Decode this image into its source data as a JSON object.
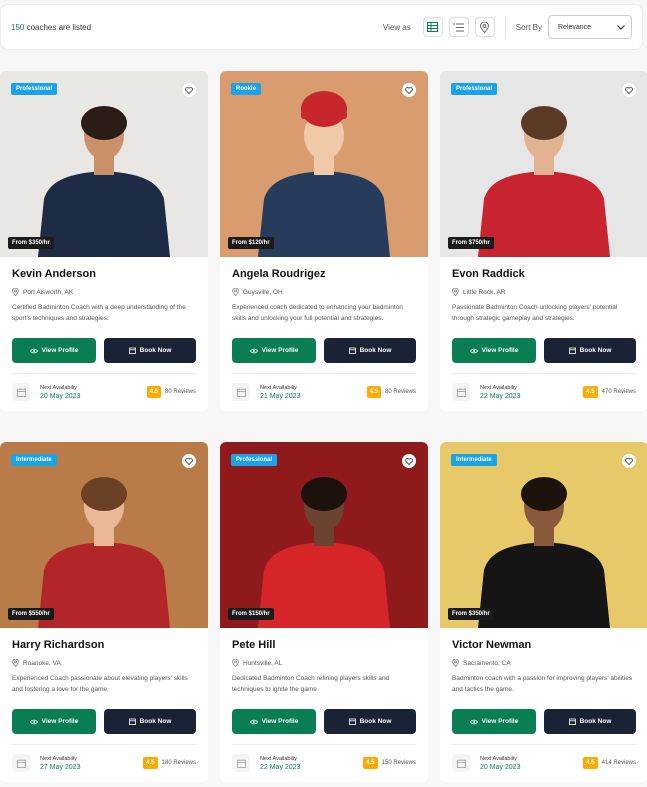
{
  "header": {
    "count_number": "150",
    "count_text": " coaches are listed",
    "view_as": "View as",
    "sort_by": "Sort By",
    "sort_value": "Relevance",
    "icons": [
      "grid-view-icon",
      "list-view-icon",
      "map-pin-icon",
      "chevron-down-icon"
    ]
  },
  "labels": {
    "view_profile": "View Profile",
    "book_now": "Book Now",
    "next_availability": "Next Availabiliy"
  },
  "coaches": [
    {
      "badge": "Professional",
      "price": "From $350/hr",
      "name": "Kevin Anderson",
      "location": "Port Alsworth, AK",
      "description": "Certified Badminton Coach with a deep understanding of the sport's techniques and strategies.",
      "date": "20 May 2023",
      "rating": "4.5",
      "reviews": "80 Reviews",
      "bg": "#e9e7e4",
      "skin": "#c9906a",
      "hair": "#2a1d15",
      "shirt": "#1d2b45",
      "hat": ""
    },
    {
      "badge": "Rookie",
      "price": "From $120/hr",
      "name": "Angela Roudrigez",
      "location": "Guysville, OH",
      "description": "Experienced coach dedicated to enhancing your badminton skills and unlocking your full potential and strategies.",
      "date": "21 May 2023",
      "rating": "4.5",
      "reviews": "80 Reviews",
      "bg": "#d89c6e",
      "skin": "#f0c9a8",
      "hair": "#e4c486",
      "shirt": "#273b5c",
      "hat": "#c7262b"
    },
    {
      "badge": "Professional",
      "price": "From $750/hr",
      "name": "Evon Raddick",
      "location": "Little Rock, AR",
      "description": "Passionate Badminton Coach unlocking players' potential through strategic gameplay and strategies.",
      "date": "22 May 2023",
      "rating": "4.5",
      "reviews": "470 Reviews",
      "bg": "#e6e6e6",
      "skin": "#e3b290",
      "hair": "#5b3a25",
      "shirt": "#c8242f",
      "hat": ""
    },
    {
      "badge": "Intermediate",
      "price": "From $550/hr",
      "name": "Harry Richardson",
      "location": "Roanoke, VA",
      "description": "Experienced Coach passionate about elevating players' skills and fostering a love for the game.",
      "date": "27 May 2023",
      "rating": "4.5",
      "reviews": "180 Reviews",
      "bg": "#b97b47",
      "skin": "#eab896",
      "hair": "#6a4124",
      "shirt": "#b2262a",
      "hat": ""
    },
    {
      "badge": "Professional",
      "price": "From $150/hr",
      "name": "Pete Hill",
      "location": "Huntsville, AL",
      "description": "Dedicated Badminton Coach refining players skills and techniques to ignite the game",
      "date": "22 May 2023",
      "rating": "4.5",
      "reviews": "150 Reviews",
      "bg": "#8f1a1c",
      "skin": "#6b4331",
      "hair": "#1c120c",
      "shirt": "#d6262a",
      "hat": ""
    },
    {
      "badge": "Intermediate",
      "price": "From $350/hr",
      "name": "Victor Newman",
      "location": "Sacramento, CA",
      "description": "Badminton coach with a passion for improving players' abilities and tactics the game.",
      "date": "20 May 2023",
      "rating": "4.5",
      "reviews": "414 Reviews",
      "bg": "#e7c96a",
      "skin": "#8b5a3c",
      "hair": "#1d130d",
      "shirt": "#151515",
      "hat": ""
    }
  ]
}
